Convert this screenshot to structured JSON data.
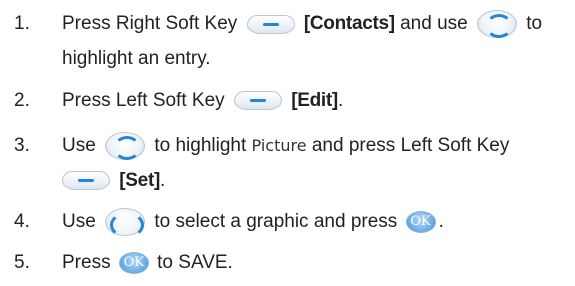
{
  "steps": [
    {
      "num": "1.",
      "pre": "Press Right Soft Key",
      "bold": "[Contacts]",
      "mid": "and use",
      "post": "to",
      "cont": "highlight an entry."
    },
    {
      "num": "2.",
      "pre": "Press Left Soft Key",
      "bold": "[Edit]",
      "end": "."
    },
    {
      "num": "3.",
      "pre": "Use",
      "mid": "to highlight",
      "option": "Picture",
      "post": "and press Left Soft Key",
      "cont_bold": "[Set]",
      "end": "."
    },
    {
      "num": "4.",
      "pre": "Use",
      "mid": "to select a graphic and press",
      "end": "."
    },
    {
      "num": "5.",
      "pre": "Press",
      "post": "to SAVE."
    }
  ],
  "icons": {
    "soft_key": "soft-key-icon",
    "nav_up_down": "nav-up-down-icon",
    "nav_all": "nav-four-way-icon",
    "ok": "ok-key-icon",
    "ok_label": "OK"
  }
}
